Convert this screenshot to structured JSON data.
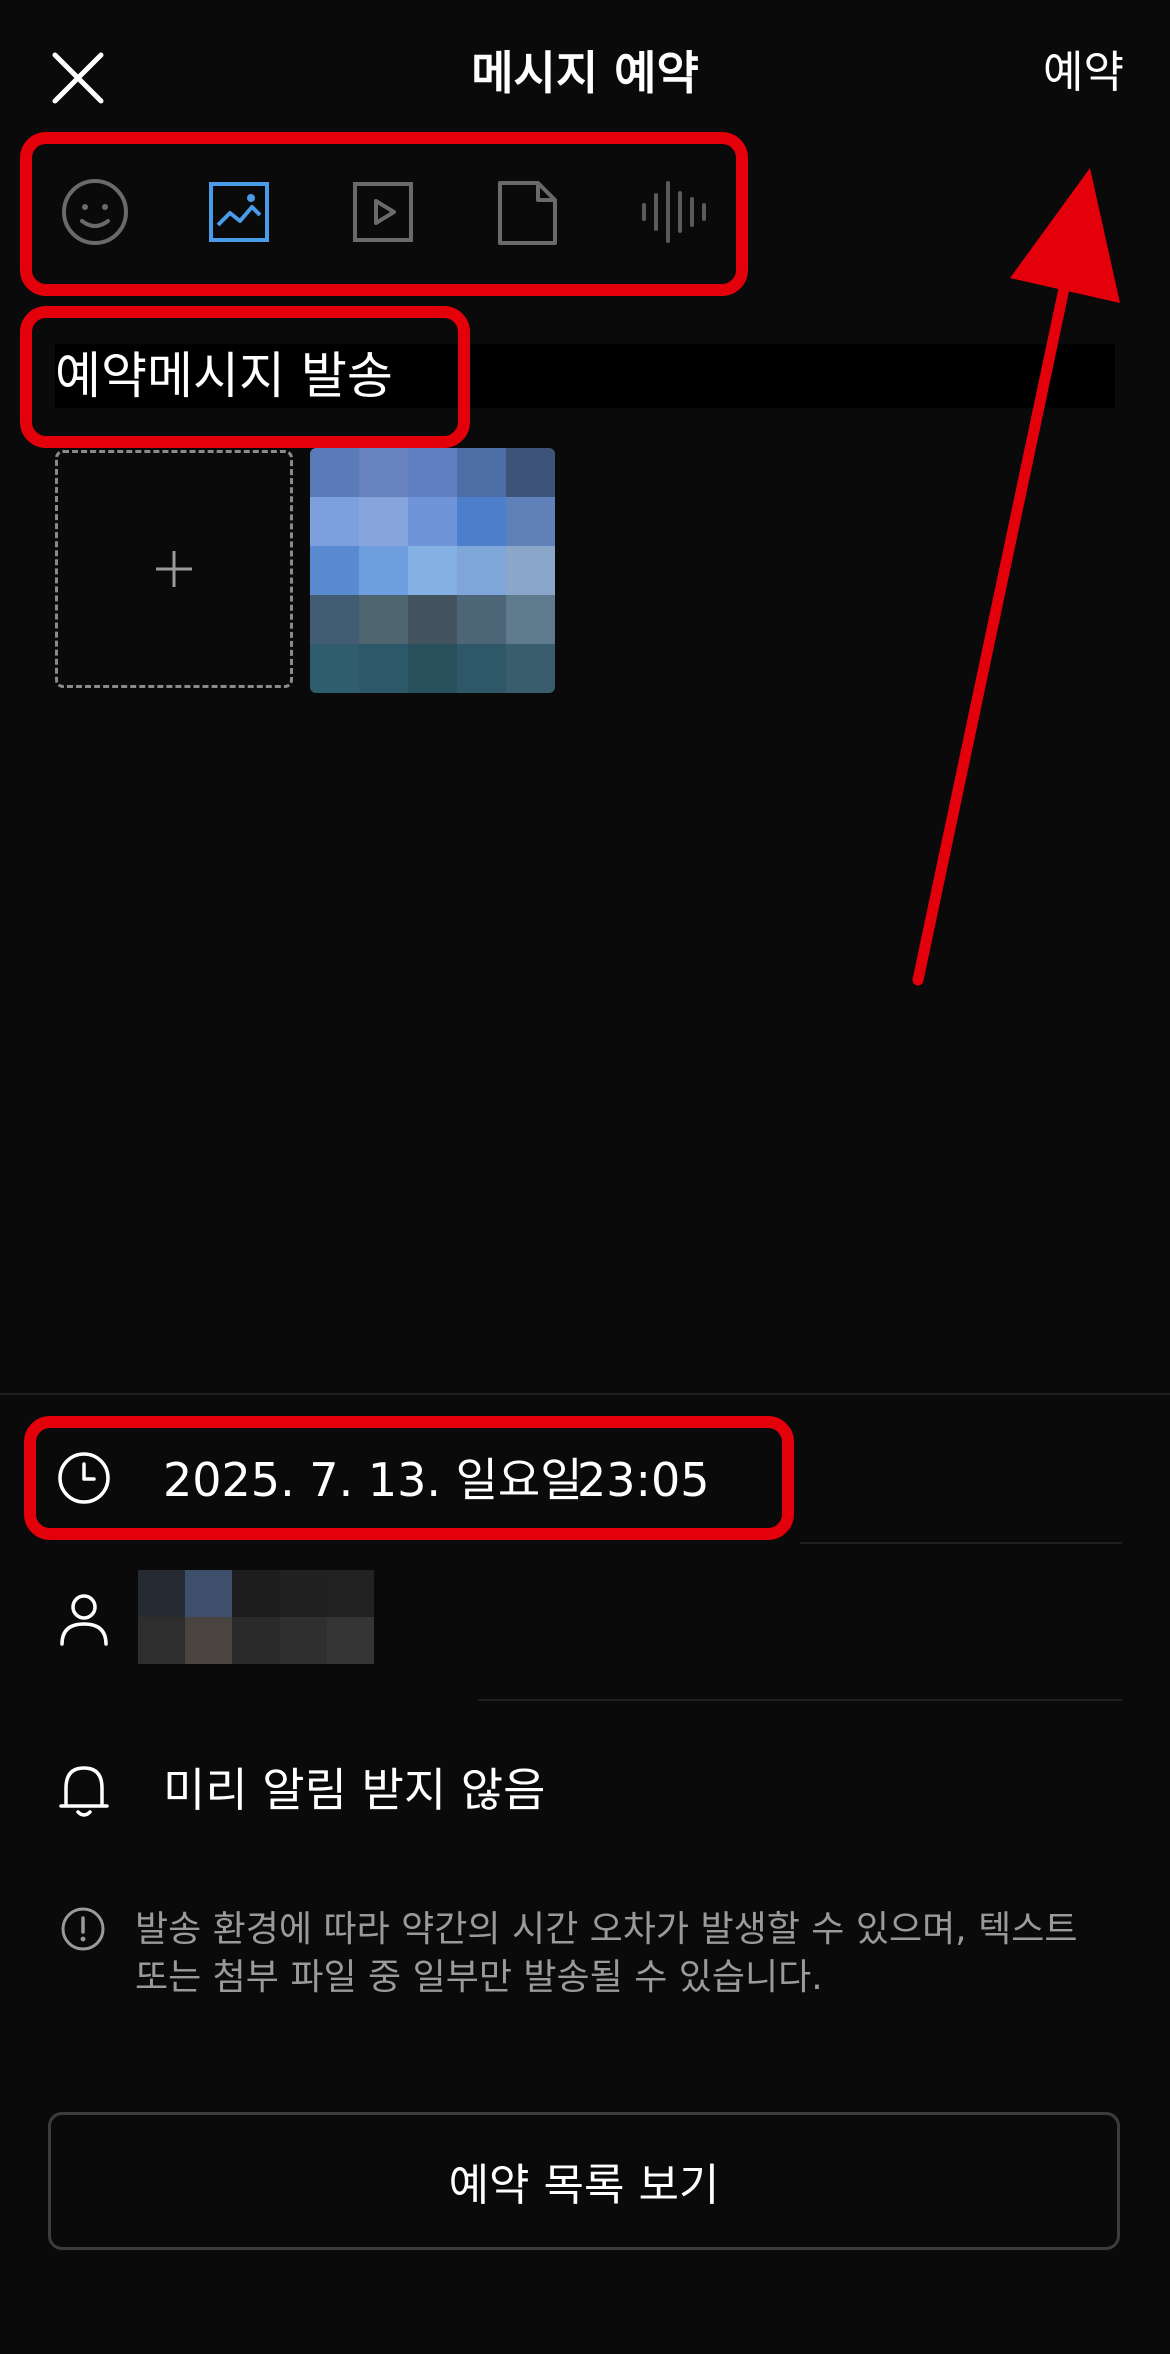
{
  "header": {
    "title": "메시지 예약",
    "close_icon": "close-icon",
    "reserve_label": "예약"
  },
  "toolbar": {
    "items": [
      {
        "icon": "emoji-icon",
        "active": false
      },
      {
        "icon": "image-icon",
        "active": true
      },
      {
        "icon": "video-icon",
        "active": false
      },
      {
        "icon": "file-icon",
        "active": false
      },
      {
        "icon": "voice-icon",
        "active": false
      }
    ]
  },
  "message": {
    "text": "예약메시지 발송"
  },
  "attachments": {
    "add_icon": "plus-icon"
  },
  "schedule": {
    "date": "2025. 7. 13. 일요일",
    "time": "23:05"
  },
  "alert": {
    "label": "미리 알림 받지 않음"
  },
  "notice": {
    "line1": "발송 환경에 따라 약간의 시간 오차가 발생할 수 있으며, 텍스트",
    "line2": "또는 첨부 파일 중 일부만 발송될 수 있습니다."
  },
  "footer": {
    "button_label": "예약 목록 보기"
  },
  "colors": {
    "background": "#0a0a0a",
    "accent_blue": "#4a9be8",
    "highlight_red": "#e3000b",
    "muted_icon": "#6a6a6a"
  }
}
